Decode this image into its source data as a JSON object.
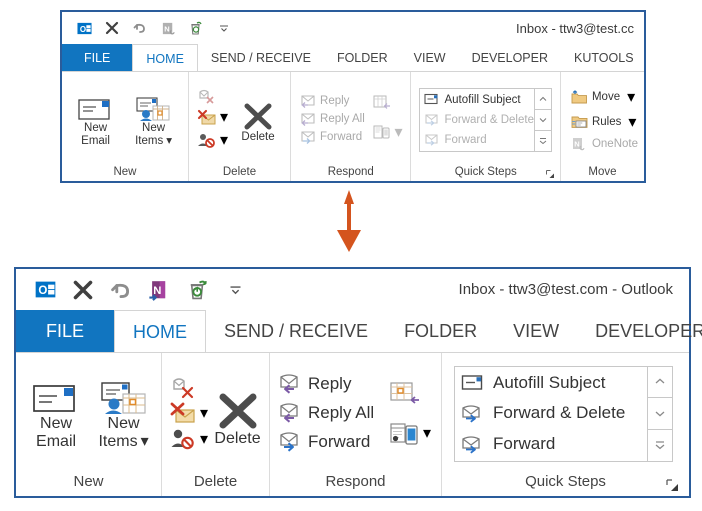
{
  "colors": {
    "window_border": "#2a5c9b",
    "file_tab_blue": "#1175C0",
    "active_tab_text": "#1175C0",
    "arrow_orange": "#D4541E",
    "disabled_gray": "#a9a9a9",
    "group_label_gray": "#444444"
  },
  "arrow": {
    "name": "down-arrow",
    "direction": "down",
    "color": "#D4541E"
  },
  "windows": [
    {
      "id": "before",
      "variant": "top",
      "title": "Inbox - ttw3@test.cc",
      "quick_access": [
        {
          "icon": "outlook-logo-icon",
          "label": "Outlook"
        },
        {
          "icon": "delete-x-icon",
          "label": "Delete"
        },
        {
          "icon": "undo-icon",
          "label": "Undo"
        },
        {
          "icon": "onenote-icon",
          "label": "OneNote"
        },
        {
          "icon": "undelete-recycle-icon",
          "label": "Undelete"
        },
        {
          "icon": "chevron-down-icon",
          "label": "Customize Quick Access Toolbar"
        }
      ],
      "tabs": [
        {
          "label": "FILE",
          "state": "file"
        },
        {
          "label": "HOME",
          "state": "active"
        },
        {
          "label": "SEND / RECEIVE",
          "state": "normal"
        },
        {
          "label": "FOLDER",
          "state": "normal"
        },
        {
          "label": "VIEW",
          "state": "normal"
        },
        {
          "label": "DEVELOPER",
          "state": "normal"
        },
        {
          "label": "KUTOOLS",
          "state": "normal"
        }
      ],
      "groups": [
        {
          "label": "New",
          "big_buttons": [
            {
              "icon": "new-email-icon",
              "line1": "New",
              "line2": "Email",
              "caret": false
            },
            {
              "icon": "new-items-icon",
              "line1": "New",
              "line2": "Items",
              "caret": true
            }
          ],
          "small_buttons": [],
          "quick_steps": null,
          "dialog_launcher": false
        },
        {
          "label": "Delete",
          "big_buttons": [
            {
              "icon": "delete-x-big-icon",
              "line1": "Delete",
              "line2": "",
              "caret": false
            }
          ],
          "small_buttons": [
            {
              "icon": "ignore-icon",
              "label": "",
              "caret": false,
              "disabled": true
            },
            {
              "icon": "junk-icon",
              "label": "",
              "caret": true,
              "disabled": false
            },
            {
              "icon": "block-sender-icon",
              "label": "",
              "caret": true,
              "disabled": false
            }
          ],
          "quick_steps": null,
          "dialog_launcher": false
        },
        {
          "label": "Respond",
          "big_buttons": [],
          "small_buttons": [
            {
              "icon": "reply-icon",
              "label": "Reply",
              "caret": false,
              "disabled": true
            },
            {
              "icon": "reply-all-icon",
              "label": "Reply All",
              "caret": false,
              "disabled": true
            },
            {
              "icon": "forward-icon",
              "label": "Forward",
              "caret": false,
              "disabled": true
            }
          ],
          "extra_buttons": [
            {
              "icon": "meeting-icon",
              "label": "",
              "caret": false,
              "disabled": true
            },
            {
              "icon": "more-respond-icon",
              "label": "",
              "caret": true,
              "disabled": true
            }
          ],
          "quick_steps": null,
          "dialog_launcher": false
        },
        {
          "label": "Quick Steps",
          "big_buttons": [],
          "small_buttons": [],
          "quick_steps": {
            "items": [
              {
                "icon": "autofill-subject-icon",
                "label": "Autofill Subject",
                "disabled": false
              },
              {
                "icon": "forward-delete-icon",
                "label": "Forward & Delete",
                "disabled": true
              },
              {
                "icon": "forward-icon",
                "label": "Forward",
                "disabled": true
              }
            ],
            "scroll_buttons": [
              {
                "icon": "scroll-up-icon"
              },
              {
                "icon": "scroll-down-icon"
              },
              {
                "icon": "open-gallery-icon"
              }
            ]
          },
          "dialog_launcher": true
        },
        {
          "label": "Move",
          "big_buttons": [],
          "small_buttons": [
            {
              "icon": "move-folder-icon",
              "label": "Move",
              "caret": true,
              "disabled": false
            },
            {
              "icon": "rules-icon",
              "label": "Rules",
              "caret": true,
              "disabled": false
            },
            {
              "icon": "onenote-icon",
              "label": "OneNote",
              "caret": false,
              "disabled": true
            }
          ],
          "quick_steps": null,
          "dialog_launcher": false
        }
      ]
    },
    {
      "id": "after",
      "variant": "bottom",
      "title": "Inbox - ttw3@test.com - Outlook",
      "quick_access": [
        {
          "icon": "outlook-logo-icon",
          "label": "Outlook"
        },
        {
          "icon": "delete-x-icon",
          "label": "Delete"
        },
        {
          "icon": "undo-icon",
          "label": "Undo"
        },
        {
          "icon": "onenote-icon",
          "label": "OneNote"
        },
        {
          "icon": "undelete-recycle-icon",
          "label": "Undelete"
        },
        {
          "icon": "chevron-down-icon",
          "label": "Customize Quick Access Toolbar"
        }
      ],
      "tabs": [
        {
          "label": "FILE",
          "state": "file"
        },
        {
          "label": "HOME",
          "state": "active"
        },
        {
          "label": "SEND / RECEIVE",
          "state": "normal"
        },
        {
          "label": "FOLDER",
          "state": "normal"
        },
        {
          "label": "VIEW",
          "state": "normal"
        },
        {
          "label": "DEVELOPER",
          "state": "normal"
        }
      ],
      "groups": [
        {
          "label": "New",
          "big_buttons": [
            {
              "icon": "new-email-icon",
              "line1": "New",
              "line2": "Email",
              "caret": false
            },
            {
              "icon": "new-items-icon",
              "line1": "New",
              "line2": "Items",
              "caret": true
            }
          ],
          "small_buttons": [],
          "quick_steps": null,
          "dialog_launcher": false
        },
        {
          "label": "Delete",
          "big_buttons": [
            {
              "icon": "delete-x-big-icon",
              "line1": "Delete",
              "line2": "",
              "caret": false
            }
          ],
          "small_buttons": [
            {
              "icon": "ignore-icon",
              "label": "",
              "caret": false,
              "disabled": false
            },
            {
              "icon": "junk-icon",
              "label": "",
              "caret": true,
              "disabled": false
            },
            {
              "icon": "block-sender-icon",
              "label": "",
              "caret": true,
              "disabled": false
            }
          ],
          "quick_steps": null,
          "dialog_launcher": false
        },
        {
          "label": "Respond",
          "big_buttons": [],
          "small_buttons": [
            {
              "icon": "reply-icon",
              "label": "Reply",
              "caret": false,
              "disabled": false
            },
            {
              "icon": "reply-all-icon",
              "label": "Reply All",
              "caret": false,
              "disabled": false
            },
            {
              "icon": "forward-icon",
              "label": "Forward",
              "caret": false,
              "disabled": false
            }
          ],
          "extra_buttons": [
            {
              "icon": "meeting-icon",
              "label": "",
              "caret": false,
              "disabled": false
            },
            {
              "icon": "more-respond-icon",
              "label": "",
              "caret": true,
              "disabled": false
            }
          ],
          "quick_steps": null,
          "dialog_launcher": false
        },
        {
          "label": "Quick Steps",
          "big_buttons": [],
          "small_buttons": [],
          "quick_steps": {
            "items": [
              {
                "icon": "autofill-subject-icon",
                "label": "Autofill Subject",
                "disabled": false
              },
              {
                "icon": "forward-delete-icon",
                "label": "Forward & Delete",
                "disabled": false
              },
              {
                "icon": "forward-icon",
                "label": "Forward",
                "disabled": false
              }
            ],
            "scroll_buttons": [
              {
                "icon": "scroll-up-icon"
              },
              {
                "icon": "scroll-down-icon"
              },
              {
                "icon": "open-gallery-icon"
              }
            ]
          },
          "dialog_launcher": true
        }
      ]
    }
  ]
}
